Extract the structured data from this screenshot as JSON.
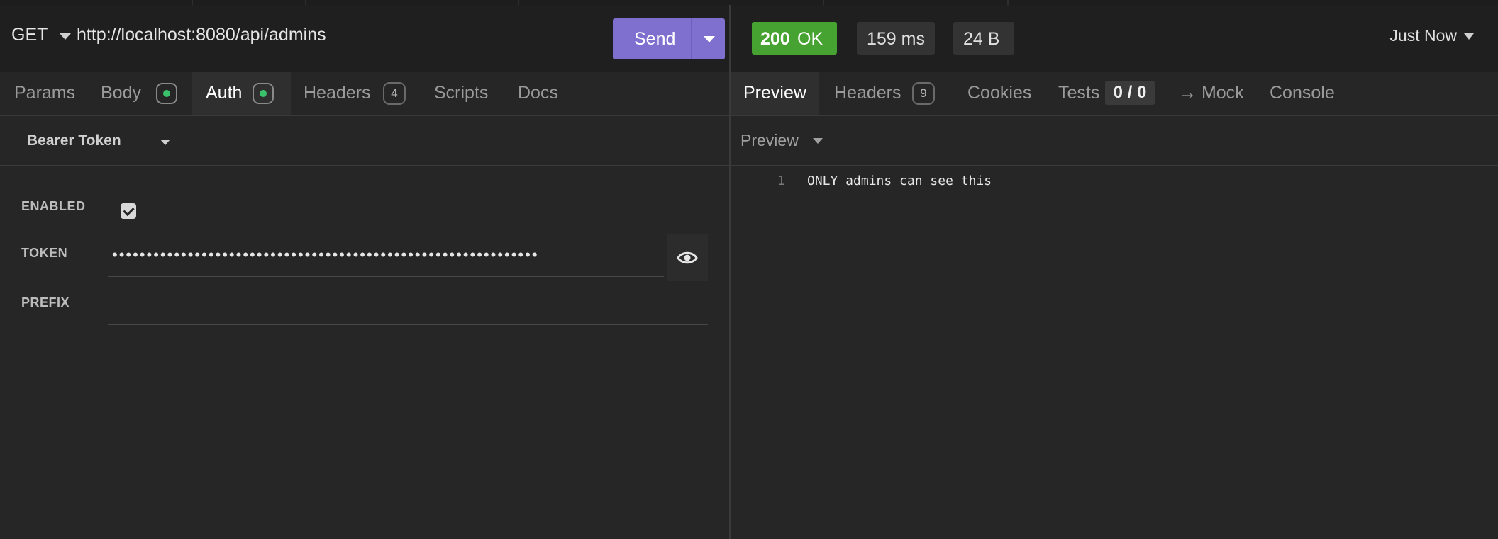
{
  "request": {
    "method": "GET",
    "url": "http://localhost:8080/api/admins",
    "send_label": "Send"
  },
  "request_tabs": [
    {
      "label": "Params"
    },
    {
      "label": "Body"
    },
    {
      "label": "Auth"
    },
    {
      "label": "Headers",
      "badge": "4"
    },
    {
      "label": "Scripts"
    },
    {
      "label": "Docs"
    }
  ],
  "auth": {
    "type": "Bearer Token",
    "enabled_label": "ENABLED",
    "enabled": true,
    "token_label": "TOKEN",
    "token_value": "••••••••••••••••••••••••••••••••••••••••••••••••••••••••••••••",
    "prefix_label": "PREFIX",
    "prefix_value": ""
  },
  "response": {
    "status_code": "200",
    "status_text": "OK",
    "time": "159 ms",
    "size": "24 B",
    "history": "Just Now"
  },
  "response_tabs": [
    {
      "label": "Preview"
    },
    {
      "label": "Headers",
      "badge": "9"
    },
    {
      "label": "Cookies"
    },
    {
      "label": "Tests",
      "badge": "0 / 0"
    },
    {
      "label": "→ Mock"
    },
    {
      "label": "Console"
    }
  ],
  "preview": {
    "mode": "Preview",
    "line_number": "1",
    "body": "ONLY admins can see this"
  },
  "colors": {
    "send": "#7f6fcf",
    "status_ok": "#46a331",
    "dot": "#39c26b"
  }
}
